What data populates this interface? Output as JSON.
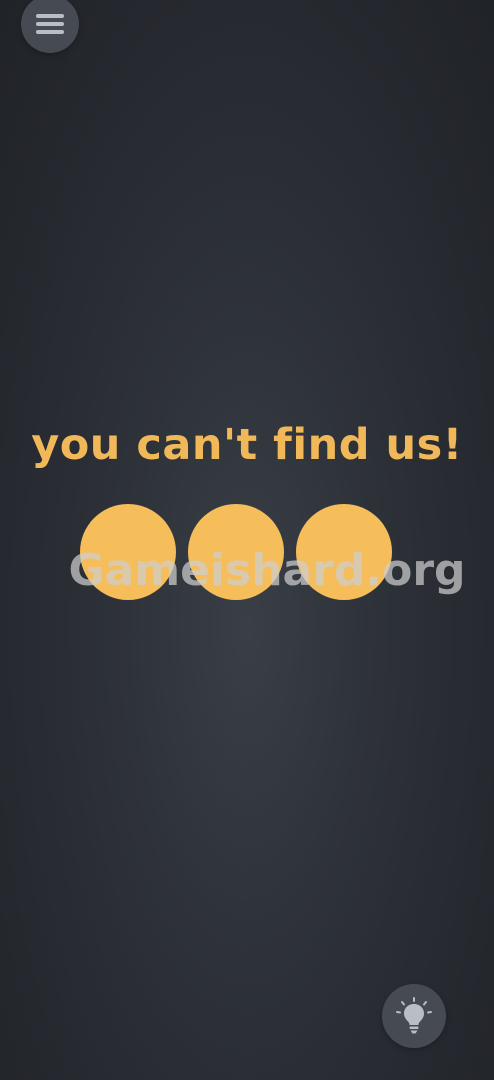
{
  "menu": {
    "icon": "hamburger-menu-icon"
  },
  "puzzle": {
    "prompt": "you can't find us!",
    "circles": [
      {
        "name": "circle-1"
      },
      {
        "name": "circle-2"
      },
      {
        "name": "circle-3"
      }
    ]
  },
  "watermark": {
    "text": "Gameishard.org"
  },
  "hint": {
    "icon": "lightbulb-icon"
  },
  "colors": {
    "accent": "#f6bd5b",
    "text": "#f1b85a",
    "background": "#2a2e34",
    "button": "#454a53",
    "icon": "#b9bec6"
  }
}
